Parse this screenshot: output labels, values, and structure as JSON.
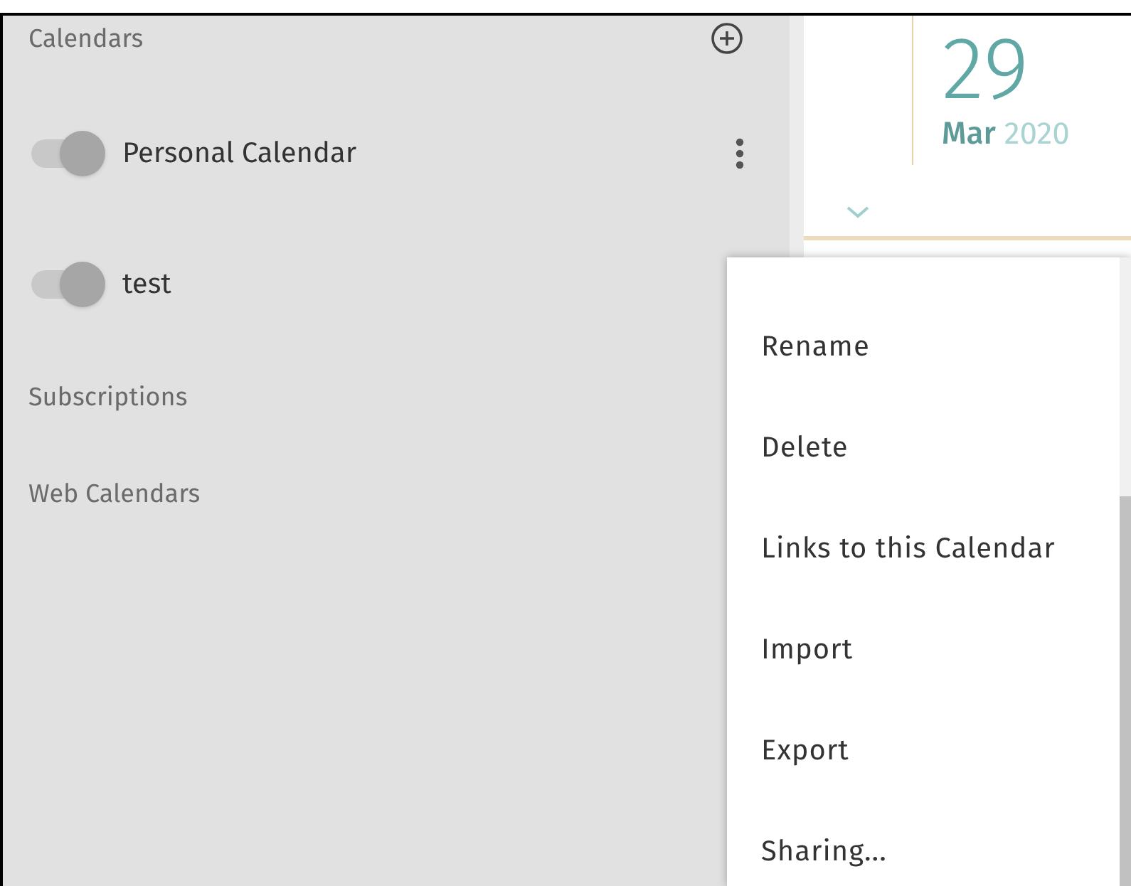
{
  "sidebar": {
    "sections": [
      {
        "title": "Calendars",
        "calendars": [
          {
            "name": "Personal Calendar",
            "on": true,
            "has_menu": true
          },
          {
            "name": "test",
            "on": true,
            "has_menu": false
          }
        ]
      },
      {
        "title": "Subscriptions"
      },
      {
        "title": "Web Calendars"
      }
    ]
  },
  "day_header": {
    "day": "29",
    "month": "Mar",
    "year": "2020"
  },
  "context_menu": {
    "items": [
      "Rename",
      "Delete",
      "Links to this Calendar",
      "Import",
      "Export",
      "Sharing..."
    ]
  }
}
